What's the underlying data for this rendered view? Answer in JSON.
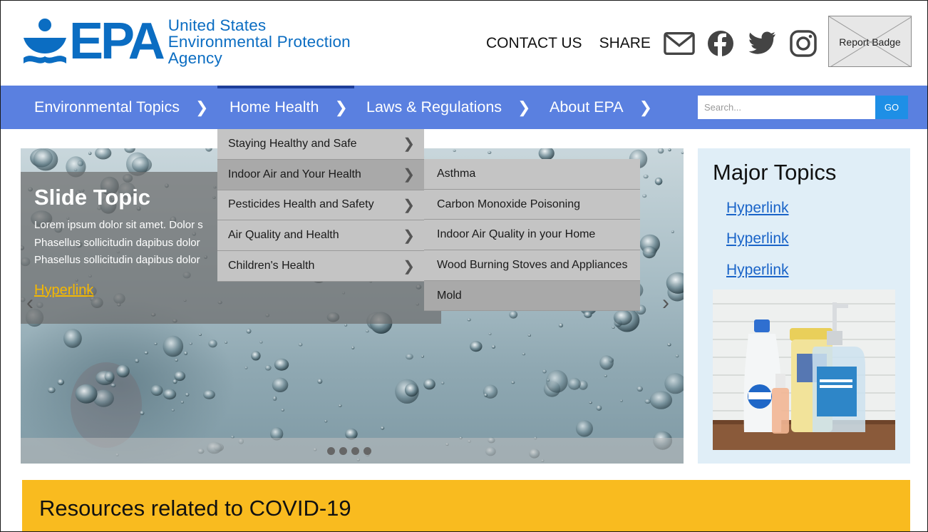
{
  "header": {
    "logo_text": "EPA",
    "org_line1": "United States",
    "org_line2": "Environmental Protection",
    "org_line3": "Agency",
    "contact_label": "CONTACT US",
    "share_label": "SHARE",
    "social_icons": [
      "mail-icon",
      "facebook-icon",
      "twitter-icon",
      "instagram-icon"
    ],
    "report_badge": "Report Badge"
  },
  "nav": {
    "items": [
      {
        "label": "Environmental Topics"
      },
      {
        "label": "Home Health"
      },
      {
        "label": "Laws & Regulations"
      },
      {
        "label": "About EPA"
      }
    ],
    "search_placeholder": "Search...",
    "go_label": "GO"
  },
  "dropdown": {
    "items": [
      {
        "label": "Staying Healthy and Safe"
      },
      {
        "label": "Indoor Air and Your Health"
      },
      {
        "label": "Pesticides Health and Safety"
      },
      {
        "label": "Air Quality and Health"
      },
      {
        "label": "Children's Health"
      }
    ],
    "submenu": [
      {
        "label": "Asthma"
      },
      {
        "label": "Carbon Monoxide Poisoning"
      },
      {
        "label": "Indoor Air Quality in your Home"
      },
      {
        "label": "Wood Burning Stoves and Appliances"
      },
      {
        "label": "Mold"
      }
    ]
  },
  "hero": {
    "title": "Slide Topic",
    "line1": "Lorem ipsum dolor sit amet. Dolor s",
    "line2": "Phasellus sollicitudin dapibus dolor",
    "line3": "Phasellus sollicitudin dapibus dolor",
    "link": "Hyperlink"
  },
  "panel": {
    "title": "Major Topics",
    "links": [
      "Hyperlink",
      "Hyperlink",
      "Hyperlink"
    ]
  },
  "covid": {
    "title": "Resources related to COVID-19"
  },
  "colors": {
    "brand_blue": "#0b6dc2",
    "nav_blue": "#5a80e0",
    "go_button": "#1e8fe6",
    "covid_banner": "#f9bb1f",
    "panel_bg": "#e0eef7",
    "hero_link": "#f5b800"
  }
}
